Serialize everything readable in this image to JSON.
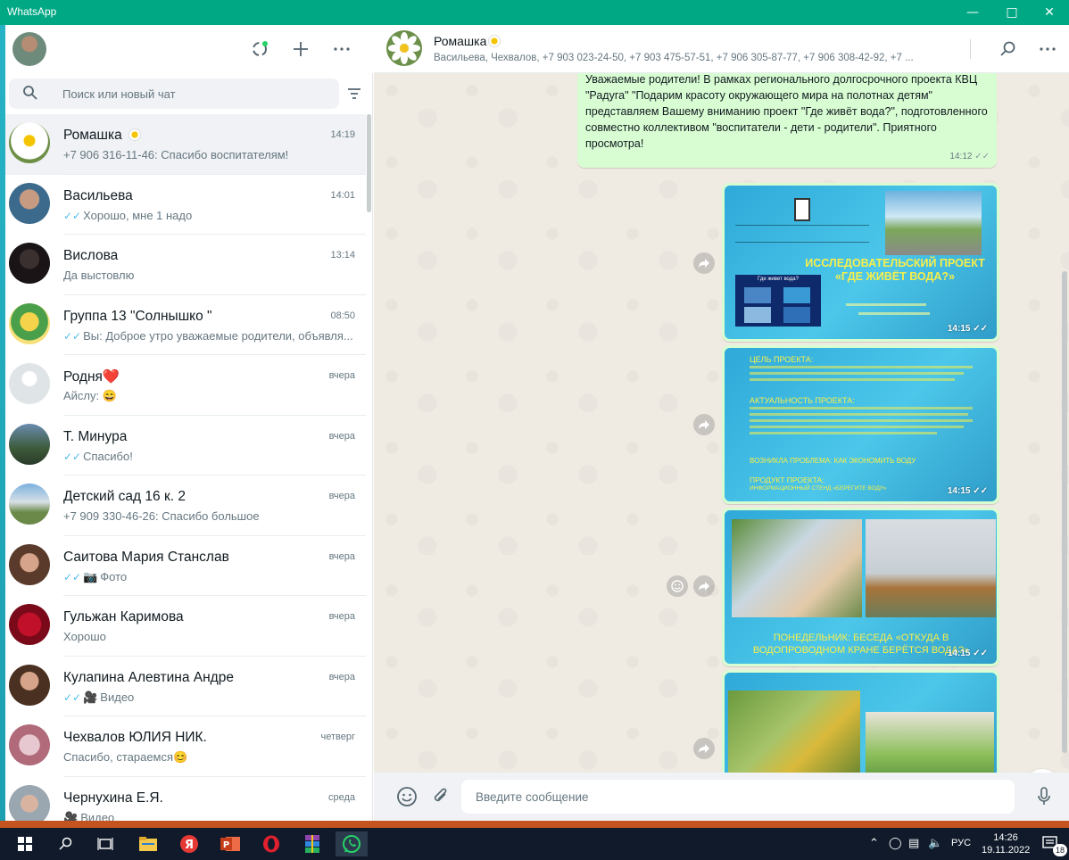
{
  "window": {
    "title": "WhatsApp"
  },
  "sidebar": {
    "search_placeholder": "Поиск или новый чат",
    "chats": [
      {
        "name": "Ромашка",
        "time": "14:19",
        "preview": "+7 906 316-11-46: Спасибо воспитателям!",
        "ticks": "",
        "media": "",
        "active": true
      },
      {
        "name": "Васильева",
        "time": "14:01",
        "preview": "Хорошо, мне 1 надо",
        "ticks": "✓✓",
        "media": ""
      },
      {
        "name": "Вислова",
        "time": "13:14",
        "preview": "Да выстовлю",
        "ticks": "",
        "media": ""
      },
      {
        "name": "Группа 13 \"Солнышко \"",
        "time": "08:50",
        "preview": "Вы: Доброе утро уважаемые родители, объявля...",
        "ticks": "✓✓",
        "media": ""
      },
      {
        "name": "Родня❤️",
        "time": "вчера",
        "preview": "Айслу: 😄",
        "ticks": "",
        "media": ""
      },
      {
        "name": "Т. Минура",
        "time": "вчера",
        "preview": "Спасибо!",
        "ticks": "✓✓",
        "media": ""
      },
      {
        "name": "Детский сад 16 к. 2",
        "time": "вчера",
        "preview": "+7 909 330-46-26: Спасибо большое",
        "ticks": "",
        "media": ""
      },
      {
        "name": "Саитова Мария Станслав",
        "time": "вчера",
        "preview": "Фото",
        "ticks": "✓✓",
        "media": "📷"
      },
      {
        "name": "Гульжан Каримова",
        "time": "вчера",
        "preview": "Хорошо",
        "ticks": "",
        "media": ""
      },
      {
        "name": "Кулапина Алевтина Андре",
        "time": "вчера",
        "preview": "Видео",
        "ticks": "✓✓",
        "media": "🎥"
      },
      {
        "name": "Чехвалов ЮЛИЯ НИК.",
        "time": "четверг",
        "preview": "Спасибо, стараемся😊",
        "ticks": "",
        "media": ""
      },
      {
        "name": "Чернухина Е.Я.",
        "time": "среда",
        "preview": "Видео",
        "ticks": "",
        "media": "🎥"
      }
    ]
  },
  "conversation": {
    "title": "Ромашка",
    "subtitle": "Васильева, Чехвалов, +7 903 023-24-50, +7 903 475-57-51, +7 906 305-87-77, +7 906 308-42-92, +7 ...",
    "text_message": {
      "text": "Уважаемые родители! В рамках регионального долгосрочного проекта КВЦ \"Радуга\" \"Подарим красоту окружающего мира на полотнах детям\" представляем Вашему вниманию проект \"Где живёт вода?\", подготовленного совместно коллективом \"воспитатели - дети - родители\". Приятного просмотра!",
      "time": "14:12"
    },
    "images": [
      {
        "time": "14:15",
        "heading": "ИССЛЕДОВАТЕЛЬСКИЙ ПРОЕКТ «ГДЕ ЖИВЁТ ВОДА?»",
        "thumb_caption": "Где живет вода?"
      },
      {
        "time": "14:15",
        "goal_label": "ЦЕЛЬ ПРОЕКТА:",
        "relevance_label": "АКТУАЛЬНОСТЬ ПРОЕКТА:",
        "problem_label": "ВОЗНИКЛА ПРОБЛЕМА: КАК ЭКОНОМИТЬ ВОДУ",
        "product_label": "ПРОДУКТ ПРОЕКТА:",
        "product_text": "ИНФОРМАЦИОННЫЙ СТЕНД «БЕРЕГИТЕ ВОДУ»"
      },
      {
        "time": "14:15",
        "caption": "ПОНЕДЕЛЬНИК: БЕСЕДА «ОТКУДА В ВОДОПРОВОДНОМ КРАНЕ БЕРЁТСЯ ВОДА?»"
      },
      {
        "time": ""
      }
    ],
    "composer_placeholder": "Введите сообщение"
  },
  "taskbar": {
    "lang": "РУС",
    "time": "14:26",
    "date": "19.11.2022",
    "notifications": "18"
  },
  "colors": {
    "accent": "#00a884",
    "outgoing_bubble": "#d9fdd3",
    "chat_background": "#efeae2",
    "read_ticks": "#53bdeb"
  }
}
